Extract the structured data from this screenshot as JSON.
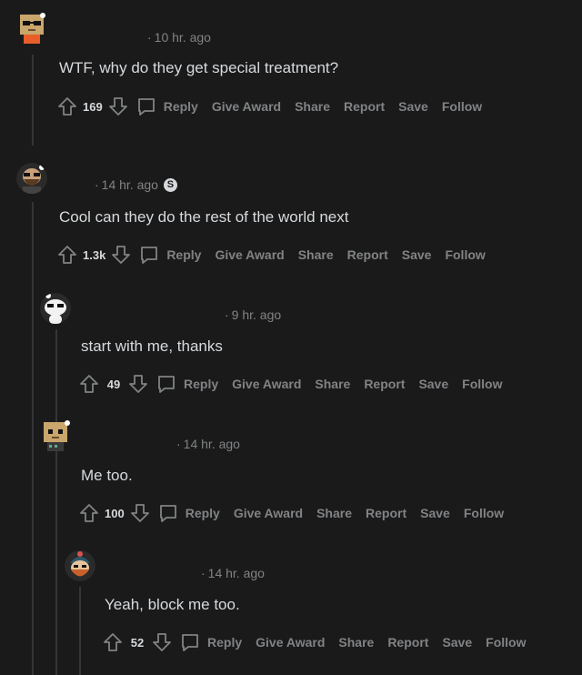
{
  "comments": [
    {
      "avatar": "box-head-sunglasses-avatar",
      "time": "10 hr. ago",
      "has_badge": false,
      "text": "WTF, why do they get special treatment?",
      "score": "169",
      "actions": {
        "reply": "Reply",
        "award": "Give Award",
        "share": "Share",
        "report": "Report",
        "save": "Save",
        "follow": "Follow"
      }
    },
    {
      "avatar": "bearded-sunglasses-avatar",
      "time": "14 hr. ago",
      "has_badge": true,
      "badge": "S",
      "text": "Cool can they do the rest of the world next",
      "score": "1.3k",
      "actions": {
        "reply": "Reply",
        "award": "Give Award",
        "share": "Share",
        "report": "Report",
        "save": "Save",
        "follow": "Follow"
      }
    },
    {
      "avatar": "snoo-sunglasses-avatar",
      "time": "9 hr. ago",
      "has_badge": false,
      "text": "start with me, thanks",
      "score": "49",
      "actions": {
        "reply": "Reply",
        "award": "Give Award",
        "share": "Share",
        "report": "Report",
        "save": "Save",
        "follow": "Follow"
      }
    },
    {
      "avatar": "box-head-avatar",
      "time": "14 hr. ago",
      "has_badge": false,
      "text": "Me too.",
      "score": "100",
      "actions": {
        "reply": "Reply",
        "award": "Give Award",
        "share": "Share",
        "report": "Report",
        "save": "Save",
        "follow": "Follow"
      }
    },
    {
      "avatar": "beanie-bearded-avatar",
      "time": "14 hr. ago",
      "has_badge": false,
      "text": "Yeah, block me too.",
      "score": "52",
      "actions": {
        "reply": "Reply",
        "award": "Give Award",
        "share": "Share",
        "report": "Report",
        "save": "Save",
        "follow": "Follow"
      }
    }
  ],
  "colors": {
    "background": "#1a1a1b",
    "text": "#d7dadc",
    "muted": "#818384",
    "thread_line": "#343536"
  }
}
